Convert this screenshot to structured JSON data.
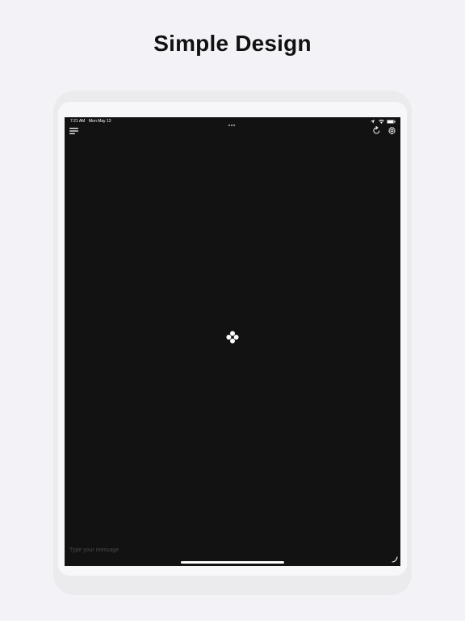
{
  "headline": "Simple Design",
  "status_bar": {
    "time": "7:21 AM",
    "date": "Mon May 13"
  },
  "header": {
    "menu_icon": "hamburger-menu-icon",
    "refresh_icon": "refresh-icon",
    "settings_icon": "gear-icon"
  },
  "center_icon": "four-dot-logo-icon",
  "composer": {
    "placeholder": "Type your message",
    "send_icon": "send-corner-icon"
  },
  "colors": {
    "background": "#f2f2f7",
    "screen": "#121212",
    "foreground": "#ffffff"
  }
}
